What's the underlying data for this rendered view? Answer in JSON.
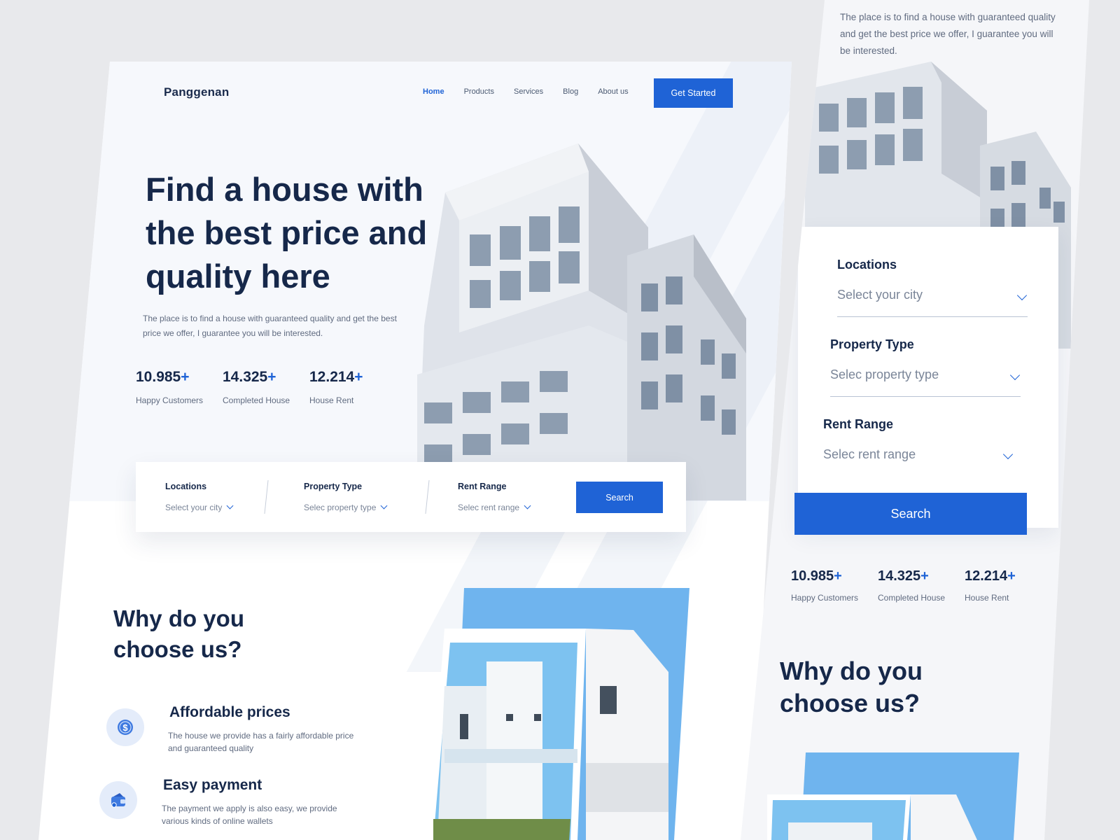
{
  "desktop": {
    "brand": "Panggenan",
    "nav": [
      "Home",
      "Products",
      "Services",
      "Blog",
      "About us"
    ],
    "cta": "Get Started",
    "hero": {
      "title_lines": [
        "Find a house with",
        "the best price and",
        "quality here"
      ],
      "subtitle": "The place is to find a house with guaranteed quality and get the best price we offer, I guarantee you will be interested."
    },
    "stats": [
      {
        "value": "10.985",
        "plus": "+",
        "label": "Happy Customers"
      },
      {
        "value": "14.325",
        "plus": "+",
        "label": "Completed House"
      },
      {
        "value": "12.214",
        "plus": "+",
        "label": "House Rent"
      }
    ],
    "search": {
      "fields": [
        {
          "title": "Locations",
          "value": "Select your city"
        },
        {
          "title": "Property Type",
          "value": "Selec property type"
        },
        {
          "title": "Rent Range",
          "value": "Selec rent range"
        }
      ],
      "button": "Search"
    },
    "why": {
      "title_lines": [
        "Why do you",
        "choose us?"
      ],
      "features": [
        {
          "title": "Affordable prices",
          "desc": "The house we provide has a fairly affordable price and guaranteed quality",
          "icon": "dollar-coin-icon"
        },
        {
          "title": "Easy payment",
          "desc": "The payment we apply is also easy, we provide various kinds of online wallets",
          "icon": "wallet-icon"
        }
      ]
    }
  },
  "mobile": {
    "subtitle": "The place is to find a house with guaranteed quality and get the best price we offer, I guarantee you will be interested.",
    "search": {
      "fields": [
        {
          "title": "Locations",
          "value": "Select your city"
        },
        {
          "title": "Property Type",
          "value": "Selec property type"
        },
        {
          "title": "Rent Range",
          "value": "Selec rent range"
        }
      ],
      "button": "Search"
    },
    "stats": [
      {
        "value": "10.985",
        "plus": "+",
        "label": "Happy Customers"
      },
      {
        "value": "14.325",
        "plus": "+",
        "label": "Completed House"
      },
      {
        "value": "12.214",
        "plus": "+",
        "label": "House Rent"
      }
    ],
    "why_title_lines": [
      "Why do you",
      "choose us?"
    ]
  },
  "colors": {
    "accent": "#1f63d6",
    "heading": "#16284a",
    "muted": "#606b80",
    "background": "#e8e9ec"
  }
}
